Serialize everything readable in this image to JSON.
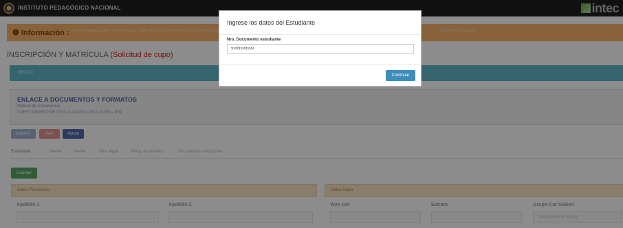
{
  "header": {
    "brand": "INSTITUTO PEDAGÓGICO NACIONAL",
    "logo_text": "intec"
  },
  "info": {
    "title": "Información :",
    "text": "ESTE FORMULARIO SE ESTUDIA PARA REALIZAR EL PROCESO DE SOLICITUD",
    "text_right": "NIO FORMULARIO"
  },
  "page": {
    "title": "INSCRIPCIÓN Y MATRÍCULA",
    "subtitle": "(Solicitud de cupo)"
  },
  "grado": {
    "label": "GRADO"
  },
  "links": {
    "title": "ENLACE A DOCUMENTOS Y FORMATOS",
    "items": [
      "Manual de Convivencia",
      "CUESTIONARIO DE VINCULACIÓN CON LA UPN - IPN"
    ]
  },
  "actions": {
    "imprimir": "Imprimir",
    "salir": "Salir",
    "ayuda": "Ayuda",
    "guardar": "Guardar"
  },
  "tabs": [
    "Estudiante",
    "Madre",
    "Padre",
    "Tutor legal",
    "Resp. económico",
    "Documentos Inscripción"
  ],
  "sections": {
    "personal": "Datos Personales",
    "hogar": "Datos hogar"
  },
  "fields": {
    "apellido1": "Apellido 1",
    "apellido2": "Apellido 2",
    "vive_con": "Vive con",
    "estrato": "Estrato",
    "grupo_sisben": "Grupo-Cat Sisben",
    "grupo_sisben_placeholder": "[seleccione el sisben]"
  },
  "modal": {
    "title": "Ingrese los datos del Estudiante",
    "field_label": "Nro. Documento estudiante",
    "field_value": "9999999999",
    "button": "Continuar"
  },
  "colors": {
    "accent": "#3c8dbc",
    "info": "#f6b26b",
    "grado": "#5fb7c8",
    "success": "#52a862"
  },
  "icons": {
    "info": "info-circle-icon",
    "dropdown": "chevron-down-icon",
    "seal": "institution-seal-icon"
  }
}
